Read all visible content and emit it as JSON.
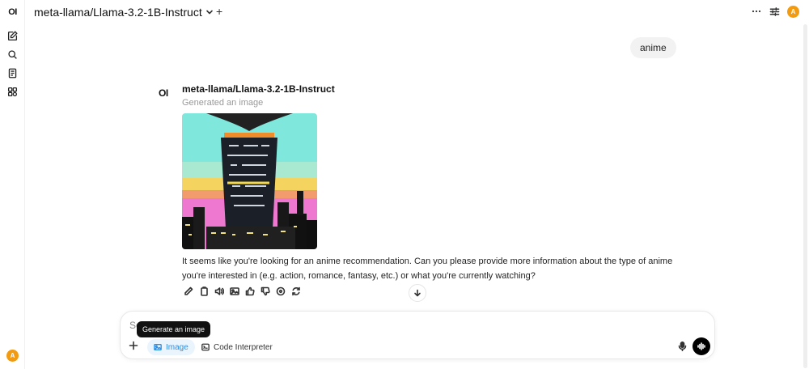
{
  "sidebar": {
    "logo": "OI",
    "icons": [
      "new-chat-icon",
      "search-icon",
      "notes-icon",
      "workspace-icon"
    ],
    "user_initial": "A"
  },
  "header": {
    "model_name": "meta-llama/Llama-3.2-1B-Instruct",
    "new_model_symbol": "+",
    "user_initial": "A"
  },
  "chat": {
    "user_message": "anime",
    "assistant": {
      "logo": "OI",
      "model_name": "meta-llama/Llama-3.2-1B-Instruct",
      "status": "Generated an image",
      "reply": "It seems like you're looking for an anime recommendation. Can you please provide more information about the type of anime you're interested in (e.g. action, romance, fantasy, etc.) or what you're currently watching?",
      "actions": [
        "edit-icon",
        "copy-icon",
        "read-aloud-icon",
        "image-icon",
        "thumbs-up-icon",
        "thumbs-down-icon",
        "info-icon",
        "regenerate-icon"
      ]
    }
  },
  "composer": {
    "placeholder_visible": "Se",
    "tooltip": "Generate an image",
    "image_label": "Image",
    "code_interpreter_label": "Code Interpreter",
    "accent_color": "#2e8de0"
  }
}
